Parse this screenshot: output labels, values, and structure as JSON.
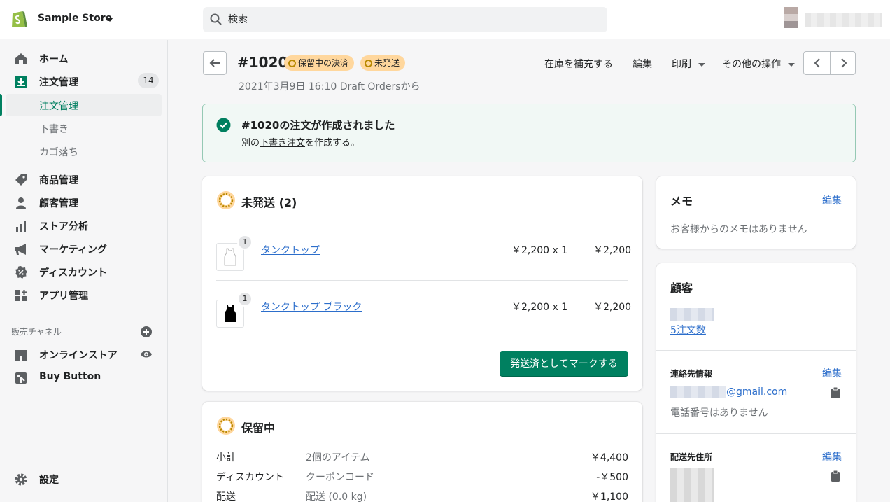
{
  "header": {
    "store_name": "Sample Store",
    "search_placeholder": "検索"
  },
  "sidebar": {
    "items": [
      {
        "label": "ホーム",
        "icon": "home-icon"
      },
      {
        "label": "注文管理",
        "icon": "orders-icon",
        "badge": "14"
      },
      {
        "label": "商品管理",
        "icon": "tag-icon"
      },
      {
        "label": "顧客管理",
        "icon": "customer-icon"
      },
      {
        "label": "ストア分析",
        "icon": "analytics-icon"
      },
      {
        "label": "マーケティング",
        "icon": "megaphone-icon"
      },
      {
        "label": "ディスカウント",
        "icon": "discount-icon"
      },
      {
        "label": "アプリ管理",
        "icon": "apps-icon"
      }
    ],
    "sub_items": [
      "注文管理",
      "下書き",
      "カゴ落ち"
    ],
    "channels_title": "販売チャネル",
    "channels": [
      {
        "label": "オンラインストア",
        "icon": "store-icon"
      },
      {
        "label": "Buy Button",
        "icon": "buy-button-icon"
      }
    ],
    "settings_label": "設定"
  },
  "order": {
    "title": "#1020",
    "badges": [
      "保留中の決済",
      "未発送"
    ],
    "subtitle": "2021年3月9日 16:10 Draft Ordersから",
    "actions": {
      "restock": "在庫を補充する",
      "edit": "編集",
      "print": "印刷",
      "more": "その他の操作"
    }
  },
  "banner": {
    "title": "#1020の注文が作成されました",
    "text_prefix": "別の",
    "text_link": "下書き注文",
    "text_suffix": "を作成する。"
  },
  "fulfillment": {
    "title": "未発送 (2)",
    "items": [
      {
        "name": "タンクトップ",
        "qty": "1",
        "price": "￥2,200 x 1",
        "total": "￥2,200"
      },
      {
        "name": "タンクトップ ブラック",
        "qty": "1",
        "price": "￥2,200 x 1",
        "total": "￥2,200"
      }
    ],
    "button": "発送済としてマークする"
  },
  "payment": {
    "title": "保留中",
    "rows": [
      {
        "label": "小計",
        "meta": "2個のアイテム",
        "value": "￥4,400"
      },
      {
        "label": "ディスカウント",
        "meta": "クーポンコード",
        "value": "-￥500"
      },
      {
        "label": "配送",
        "meta": "配送 (0.0 kg)",
        "value": "￥1,100"
      }
    ]
  },
  "notes": {
    "title": "メモ",
    "edit": "編集",
    "empty": "お客様からのメモはありません"
  },
  "customer": {
    "title": "顧客",
    "orders_link": "5注文数",
    "contact_title": "連絡先情報",
    "contact_edit": "編集",
    "email_suffix": "@gmail.com",
    "phone_empty": "電話番号はありません",
    "shipping_title": "配送先住所",
    "shipping_edit": "編集"
  },
  "colors": {
    "primary": "#008060",
    "link": "#2c6ecb",
    "attention_badge": "#ffd79d",
    "success_banner": "#f1f8f5"
  }
}
